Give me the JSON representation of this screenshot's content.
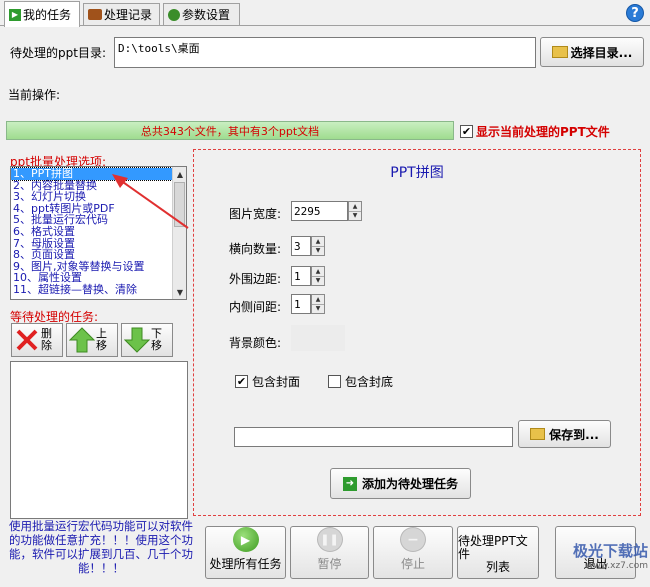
{
  "tabs": [
    {
      "label": "我的任务",
      "active": true
    },
    {
      "label": "处理记录",
      "active": false
    },
    {
      "label": "参数设置",
      "active": false
    }
  ],
  "help_label": "?",
  "dir": {
    "label": "待处理的ppt目录:",
    "value": "D:\\tools\\桌面",
    "choose_button": "选择目录..."
  },
  "current_op_label": "当前操作:",
  "progress_text": "总共343个文件，其中有3个ppt文档",
  "show_current": {
    "label": "显示当前处理的PPT文件",
    "checked": true
  },
  "options": {
    "title": "ppt批量处理选项:",
    "items": [
      "1、PPT拼图",
      "2、内容批量替换",
      "3、幻灯片切换",
      "4、ppt转图片或PDF",
      "5、批量运行宏代码",
      "6、格式设置",
      "7、母版设置",
      "8、页面设置",
      "9、图片,对象等替换与设置",
      "10、属性设置",
      "11、超链接—替换、清除"
    ],
    "selected_index": 0
  },
  "pending": {
    "title": "等待处理的任务:",
    "delete": "删除",
    "up": "上移",
    "down": "下移"
  },
  "tip": "使用批量运行宏代码功能可以对软件的功能做任意扩充！！！使用这个功能，软件可以扩展到几百、几千个功能！！！",
  "panel": {
    "title": "PPT拼图",
    "width_label": "图片宽度:",
    "width_value": "2295",
    "count_label": "横向数量:",
    "count_value": "3",
    "outer_label": "外围边距:",
    "outer_value": "1",
    "inner_label": "内侧间距:",
    "inner_value": "1",
    "bg_label": "背景颜色:",
    "bg_color": "#ececec",
    "cover_label": "包含封面",
    "cover_checked": true,
    "back_label": "包含封底",
    "back_checked": false,
    "save_path": "",
    "save_button": "保存到...",
    "add_button": "添加为待处理任务"
  },
  "bottom": {
    "process_all": "处理所有任务",
    "pause": "暂停",
    "stop": "停止",
    "list_line1": "待处理PPT文件",
    "list_line2": "列表",
    "exit": "退出"
  },
  "watermark": {
    "text": "极光下载站",
    "url": "www.xz7.com"
  },
  "colors": {
    "accent_red": "#d40000",
    "list_blue": "#1a1ab0",
    "selected": "#3399ff",
    "progress_green": "#9fdc8f"
  }
}
